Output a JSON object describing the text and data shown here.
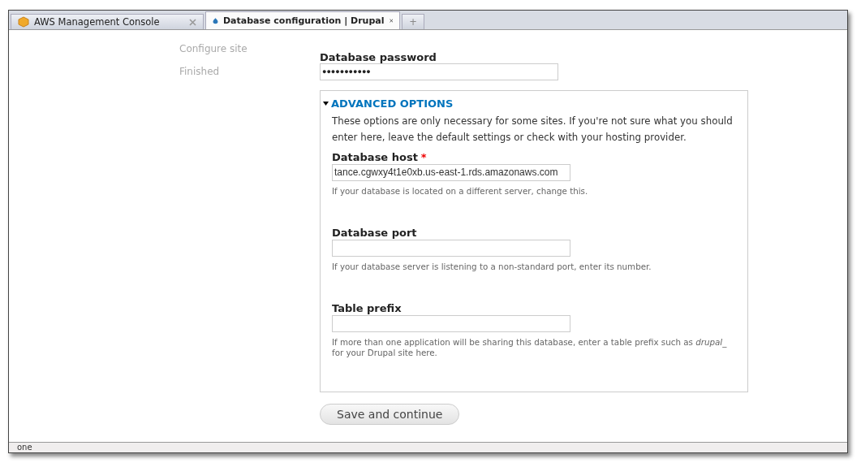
{
  "tabs": [
    {
      "label": "AWS Management Console",
      "selected": false
    },
    {
      "label": "Database configuration | Drupal",
      "selected": true
    }
  ],
  "new_tab": "+",
  "steps": [
    {
      "label": "Configure site"
    },
    {
      "label": "Finished"
    }
  ],
  "password": {
    "label": "Database password",
    "value": "●●●●●●●●●●●"
  },
  "advanced": {
    "title": "ADVANCED OPTIONS",
    "expanded": true,
    "description": "These options are only necessary for some sites. If you're not sure what you should enter here, leave the default settings or check with your hosting provider.",
    "fields": [
      {
        "label": "Database host",
        "required_mark": "*",
        "value": "tance.cgwxy4t1e0xb.us-east-1.rds.amazonaws.com",
        "help": "If your database is located on a different server, change this."
      },
      {
        "label": "Database port",
        "help": "If your database server is listening to a non-standard port, enter its number."
      },
      {
        "label": "Table prefix",
        "help": "If more than one application will be sharing this database, enter a table prefix such as *drupal_* for your Drupal site here."
      }
    ]
  },
  "submit": "Save and continue",
  "status_bar": "one"
}
